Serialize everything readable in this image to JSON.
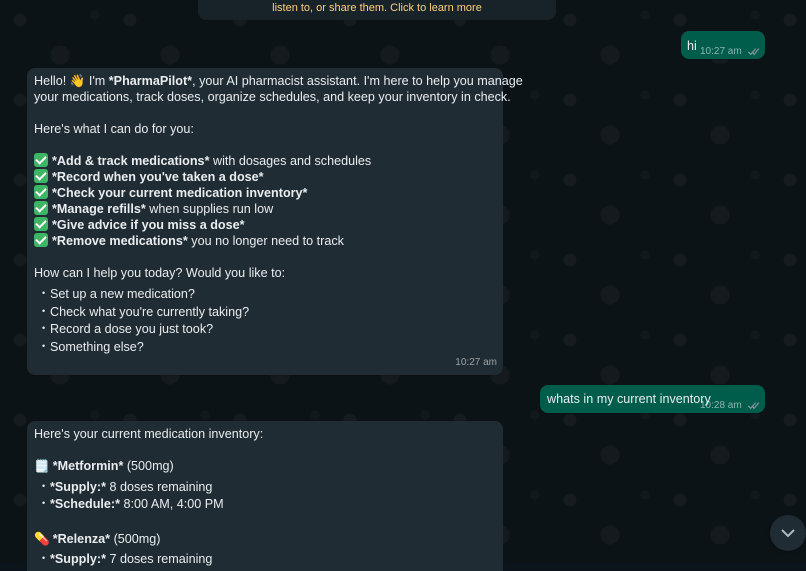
{
  "encryption_notice": "listen to, or share them. Click to learn more",
  "messages": {
    "hi": {
      "text": "hi",
      "time": "10:27 am"
    },
    "welcome": {
      "intro_pre": "Hello! 👋 I'm ",
      "intro_bold": "*PharmaPilot*",
      "intro_post_1": ", your AI pharmacist assistant. I'm here to help you manage",
      "intro_post_2": "your medications, track doses, organize schedules, and keep your inventory in check.",
      "capabilities_heading": "Here's what I can do for you:",
      "capabilities": [
        {
          "bold": "*Add & track medications*",
          "rest": " with dosages and schedules"
        },
        {
          "bold": "*Record when you've taken a dose*",
          "rest": ""
        },
        {
          "bold": "*Check your current medication inventory*",
          "rest": ""
        },
        {
          "bold": "*Manage refills*",
          "rest": " when supplies run low"
        },
        {
          "bold": "*Give advice if you miss a dose*",
          "rest": ""
        },
        {
          "bold": "*Remove medications*",
          "rest": " you no longer need to track"
        }
      ],
      "question": "How can I help you today? Would you like to:",
      "options": [
        "Set up a new medication?",
        "Check what you're currently taking?",
        "Record a dose you just took?",
        "Something else?"
      ],
      "time": "10:27 am"
    },
    "inventory_request": {
      "text": "whats in my current inventory",
      "time": "10:28 am"
    },
    "inventory": {
      "heading": "Here's your current medication inventory:",
      "items": [
        {
          "icon": "🗒️",
          "name": "*Metformin*",
          "dose": " (500mg)",
          "details": [
            {
              "label": "*Supply:*",
              "value": " 8 doses remaining"
            },
            {
              "label": "*Schedule:*",
              "value": " 8:00 AM, 4:00 PM"
            }
          ]
        },
        {
          "icon": "💊",
          "name": "*Relenza*",
          "dose": " (500mg)",
          "details": [
            {
              "label": "*Supply:*",
              "value": " 7 doses remaining"
            }
          ]
        }
      ]
    }
  },
  "icons": {
    "read_receipt": "double-check-icon",
    "scroll_down": "chevron-down-icon"
  },
  "colors": {
    "outgoing": "#005c4b",
    "incoming": "#202c33",
    "check": "#3eb565",
    "background": "#0b141a"
  }
}
